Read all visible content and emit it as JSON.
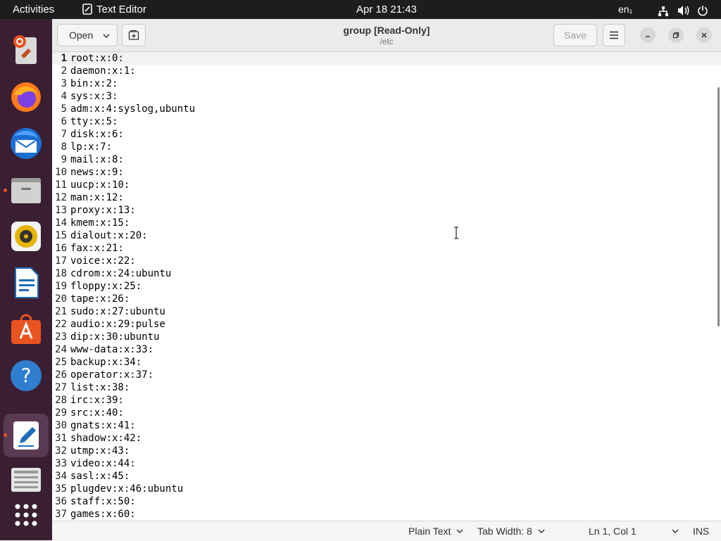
{
  "topbar": {
    "activities": "Activities",
    "app_name": "Text Editor",
    "clock": "Apr 18  21:43",
    "lang": "en₁"
  },
  "dock": {
    "apps": [
      "ubuntu-help-icon",
      "firefox-icon",
      "thunderbird-icon",
      "files-icon",
      "rhythmbox-icon",
      "libreoffice-writer-icon",
      "app-center-icon",
      "help-icon",
      "text-editor-icon",
      "ubuntu-docs-icon",
      "show-apps-icon"
    ]
  },
  "window": {
    "open_label": "Open",
    "title": "group [Read-Only]",
    "subtitle": "/etc",
    "save_label": "Save"
  },
  "lines": [
    "root:x:0:",
    "daemon:x:1:",
    "bin:x:2:",
    "sys:x:3:",
    "adm:x:4:syslog,ubuntu",
    "tty:x:5:",
    "disk:x:6:",
    "lp:x:7:",
    "mail:x:8:",
    "news:x:9:",
    "uucp:x:10:",
    "man:x:12:",
    "proxy:x:13:",
    "kmem:x:15:",
    "dialout:x:20:",
    "fax:x:21:",
    "voice:x:22:",
    "cdrom:x:24:ubuntu",
    "floppy:x:25:",
    "tape:x:26:",
    "sudo:x:27:ubuntu",
    "audio:x:29:pulse",
    "dip:x:30:ubuntu",
    "www-data:x:33:",
    "backup:x:34:",
    "operator:x:37:",
    "list:x:38:",
    "irc:x:39:",
    "src:x:40:",
    "gnats:x:41:",
    "shadow:x:42:",
    "utmp:x:43:",
    "video:x:44:",
    "sasl:x:45:",
    "plugdev:x:46:ubuntu",
    "staff:x:50:",
    "games:x:60:"
  ],
  "status": {
    "language": "Plain Text",
    "tab_width": "Tab Width: 8",
    "position": "Ln 1, Col 1",
    "mode": "INS"
  },
  "colors": {
    "accent": "#e95420",
    "dock_bg": "#3a1f33",
    "topbar_bg": "#1d1d1d"
  }
}
